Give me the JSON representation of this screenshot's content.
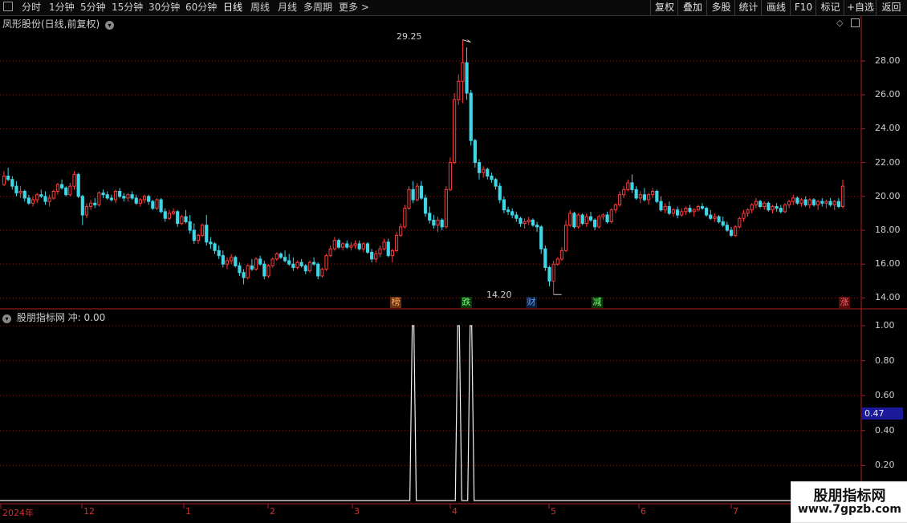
{
  "toolbar": {
    "menu_icon": "window-icon",
    "periods": [
      "分时",
      "1分钟",
      "5分钟",
      "15分钟",
      "30分钟",
      "60分钟",
      "日线",
      "周线",
      "月线",
      "多周期",
      "更多"
    ],
    "active_period": "日线",
    "right_buttons": [
      "复权",
      "叠加",
      "多股",
      "统计",
      "画线",
      "F10",
      "标记",
      "+自选",
      "返回"
    ]
  },
  "price_panel": {
    "title": "凤形股份(日线,前复权)",
    "high_label": "29.25",
    "low_label": "14.20",
    "y_ticks": [
      "28.00",
      "26.00",
      "24.00",
      "22.00",
      "20.00",
      "18.00",
      "16.00",
      "14.00"
    ],
    "badges": [
      {
        "text": "榜",
        "color": "#c86428"
      },
      {
        "text": "跌",
        "color": "#30c030"
      },
      {
        "text": "财",
        "color": "#2a78e0"
      },
      {
        "text": "减",
        "color": "#30c030"
      },
      {
        "text": "涨",
        "color": "#e03030"
      }
    ]
  },
  "indicator_panel": {
    "title": "股朋指标网 冲: 0.00",
    "y_ticks": [
      "1.00",
      "0.80",
      "0.60",
      "0.40",
      "0.20"
    ],
    "current_value": "0.47"
  },
  "x_axis": [
    "2024年",
    "12",
    "1",
    "2",
    "3",
    "4",
    "5",
    "6",
    "7"
  ],
  "watermark": {
    "line1": "股朋指标网",
    "line2": "www.7gpzb.com"
  },
  "colors": {
    "up": "#ff3b3b",
    "down": "#3fd6e6",
    "grid": "#7a1a1a",
    "axis": "#b02020"
  },
  "chart_data": {
    "type": "candlestick",
    "y_range": [
      13.5,
      29.8
    ],
    "ohlc": [
      [
        20.7,
        21.5,
        20.6,
        21.2
      ],
      [
        21.2,
        21.7,
        20.9,
        21.0
      ],
      [
        21.0,
        21.2,
        20.4,
        20.6
      ],
      [
        20.6,
        20.9,
        20.0,
        20.2
      ],
      [
        20.2,
        20.6,
        19.9,
        20.3
      ],
      [
        20.3,
        20.4,
        19.7,
        19.9
      ],
      [
        19.9,
        20.1,
        19.5,
        19.6
      ],
      [
        19.6,
        20.0,
        19.4,
        19.8
      ],
      [
        19.8,
        20.2,
        19.6,
        20.1
      ],
      [
        20.1,
        20.4,
        19.9,
        20.0
      ],
      [
        20.0,
        20.3,
        19.5,
        19.7
      ],
      [
        19.7,
        20.1,
        19.4,
        19.9
      ],
      [
        19.9,
        20.4,
        19.8,
        20.3
      ],
      [
        20.3,
        20.8,
        20.1,
        20.7
      ],
      [
        20.7,
        21.0,
        20.4,
        20.5
      ],
      [
        20.5,
        20.6,
        20.0,
        20.1
      ],
      [
        20.1,
        20.8,
        20.0,
        20.6
      ],
      [
        20.6,
        21.5,
        20.4,
        21.3
      ],
      [
        21.3,
        21.4,
        19.9,
        20.0
      ],
      [
        20.0,
        20.1,
        18.3,
        18.9
      ],
      [
        18.9,
        19.6,
        18.7,
        19.4
      ],
      [
        19.4,
        19.8,
        19.2,
        19.6
      ],
      [
        19.6,
        19.9,
        19.3,
        19.5
      ],
      [
        19.5,
        20.3,
        19.4,
        20.2
      ],
      [
        20.2,
        20.4,
        19.9,
        20.1
      ],
      [
        20.1,
        20.3,
        19.8,
        19.9
      ],
      [
        19.9,
        20.1,
        19.7,
        19.8
      ],
      [
        19.8,
        20.4,
        19.6,
        20.3
      ],
      [
        20.3,
        20.5,
        19.9,
        20.0
      ],
      [
        20.0,
        20.2,
        19.7,
        19.9
      ],
      [
        19.9,
        20.2,
        19.7,
        20.1
      ],
      [
        20.1,
        20.3,
        19.8,
        19.9
      ],
      [
        19.9,
        20.1,
        19.5,
        19.6
      ],
      [
        19.6,
        19.9,
        19.4,
        19.8
      ],
      [
        19.8,
        20.1,
        19.6,
        20.0
      ],
      [
        20.0,
        20.1,
        19.5,
        19.7
      ],
      [
        19.7,
        19.8,
        19.2,
        19.3
      ],
      [
        19.3,
        19.9,
        19.2,
        19.8
      ],
      [
        19.8,
        19.9,
        19.0,
        19.1
      ],
      [
        19.1,
        19.3,
        18.5,
        18.7
      ],
      [
        18.7,
        19.2,
        18.6,
        19.0
      ],
      [
        19.0,
        19.3,
        18.9,
        19.1
      ],
      [
        19.1,
        19.2,
        18.2,
        18.4
      ],
      [
        18.4,
        18.9,
        18.3,
        18.8
      ],
      [
        18.8,
        19.2,
        18.4,
        18.5
      ],
      [
        18.5,
        18.9,
        17.8,
        18.0
      ],
      [
        18.0,
        18.4,
        17.2,
        17.4
      ],
      [
        17.4,
        17.8,
        17.2,
        17.7
      ],
      [
        17.7,
        18.4,
        17.6,
        18.3
      ],
      [
        18.3,
        18.9,
        17.1,
        17.3
      ],
      [
        17.3,
        17.6,
        16.9,
        17.2
      ],
      [
        17.2,
        17.3,
        16.6,
        16.8
      ],
      [
        16.8,
        17.1,
        16.3,
        16.5
      ],
      [
        16.5,
        16.8,
        15.8,
        16.0
      ],
      [
        16.0,
        16.4,
        15.7,
        16.2
      ],
      [
        16.2,
        16.6,
        16.0,
        16.4
      ],
      [
        16.4,
        16.5,
        15.8,
        15.9
      ],
      [
        15.9,
        16.1,
        15.3,
        15.5
      ],
      [
        15.5,
        15.7,
        14.8,
        15.2
      ],
      [
        15.2,
        16.0,
        15.1,
        15.9
      ],
      [
        15.9,
        16.3,
        15.6,
        15.7
      ],
      [
        15.7,
        16.4,
        15.6,
        16.3
      ],
      [
        16.3,
        16.5,
        15.9,
        16.0
      ],
      [
        16.0,
        16.2,
        15.1,
        15.3
      ],
      [
        15.3,
        16.0,
        15.2,
        15.9
      ],
      [
        15.9,
        16.4,
        15.8,
        16.3
      ],
      [
        16.3,
        16.7,
        16.2,
        16.6
      ],
      [
        16.6,
        16.7,
        16.3,
        16.4
      ],
      [
        16.4,
        16.8,
        16.1,
        16.2
      ],
      [
        16.2,
        16.6,
        15.9,
        16.0
      ],
      [
        16.0,
        16.4,
        15.6,
        15.8
      ],
      [
        15.8,
        16.2,
        15.7,
        16.1
      ],
      [
        16.1,
        16.3,
        15.8,
        15.9
      ],
      [
        15.9,
        16.0,
        15.4,
        15.6
      ],
      [
        15.6,
        16.2,
        15.5,
        16.1
      ],
      [
        16.1,
        16.4,
        15.9,
        16.0
      ],
      [
        16.0,
        16.1,
        15.1,
        15.3
      ],
      [
        15.3,
        15.8,
        15.2,
        15.7
      ],
      [
        15.7,
        16.6,
        15.6,
        16.5
      ],
      [
        16.5,
        17.1,
        16.4,
        16.9
      ],
      [
        16.9,
        17.6,
        16.8,
        17.4
      ],
      [
        17.4,
        17.5,
        16.9,
        17.0
      ],
      [
        17.0,
        17.3,
        16.8,
        17.2
      ],
      [
        17.2,
        17.4,
        16.9,
        17.0
      ],
      [
        17.0,
        17.3,
        16.8,
        17.1
      ],
      [
        17.1,
        17.4,
        16.9,
        17.2
      ],
      [
        17.2,
        17.4,
        16.8,
        16.9
      ],
      [
        16.9,
        17.3,
        16.7,
        17.2
      ],
      [
        17.2,
        17.3,
        16.6,
        16.7
      ],
      [
        16.7,
        16.9,
        16.1,
        16.3
      ],
      [
        16.3,
        16.8,
        16.1,
        16.6
      ],
      [
        16.6,
        17.1,
        16.4,
        16.9
      ],
      [
        16.9,
        17.5,
        16.8,
        17.3
      ],
      [
        17.3,
        17.5,
        16.4,
        16.5
      ],
      [
        16.5,
        16.9,
        16.1,
        16.8
      ],
      [
        16.8,
        17.9,
        16.7,
        17.7
      ],
      [
        17.7,
        18.4,
        17.6,
        18.2
      ],
      [
        18.2,
        19.5,
        18.1,
        19.3
      ],
      [
        19.3,
        20.6,
        19.2,
        20.4
      ],
      [
        20.4,
        20.9,
        19.6,
        19.8
      ],
      [
        19.8,
        20.8,
        19.7,
        20.6
      ],
      [
        20.6,
        20.9,
        19.8,
        19.9
      ],
      [
        19.9,
        20.1,
        18.8,
        19.0
      ],
      [
        19.0,
        19.4,
        18.4,
        18.6
      ],
      [
        18.6,
        18.9,
        18.1,
        18.3
      ],
      [
        18.3,
        18.8,
        17.9,
        18.6
      ],
      [
        18.6,
        18.7,
        18.0,
        18.2
      ],
      [
        18.2,
        20.6,
        18.1,
        20.4
      ],
      [
        20.4,
        22.3,
        20.3,
        22.0
      ],
      [
        22.0,
        26.1,
        21.9,
        25.7
      ],
      [
        25.7,
        27.2,
        25.4,
        26.8
      ],
      [
        26.8,
        29.25,
        25.5,
        27.9
      ],
      [
        27.9,
        28.8,
        25.7,
        26.1
      ],
      [
        26.1,
        26.3,
        23.0,
        23.3
      ],
      [
        23.3,
        23.4,
        21.7,
        22.0
      ],
      [
        22.0,
        22.2,
        21.0,
        21.4
      ],
      [
        21.4,
        21.8,
        21.1,
        21.6
      ],
      [
        21.6,
        21.7,
        21.0,
        21.2
      ],
      [
        21.2,
        21.4,
        20.8,
        21.0
      ],
      [
        21.0,
        21.1,
        20.4,
        20.6
      ],
      [
        20.6,
        20.8,
        19.6,
        19.8
      ],
      [
        19.8,
        20.0,
        19.0,
        19.2
      ],
      [
        19.2,
        19.4,
        18.9,
        19.1
      ],
      [
        19.1,
        19.3,
        18.7,
        18.9
      ],
      [
        18.9,
        19.1,
        18.5,
        18.7
      ],
      [
        18.7,
        18.8,
        18.2,
        18.4
      ],
      [
        18.4,
        18.7,
        18.1,
        18.5
      ],
      [
        18.5,
        18.8,
        18.3,
        18.6
      ],
      [
        18.6,
        18.7,
        18.2,
        18.3
      ],
      [
        18.3,
        18.5,
        17.9,
        18.2
      ],
      [
        18.2,
        18.3,
        16.6,
        16.9
      ],
      [
        16.9,
        17.1,
        15.6,
        15.8
      ],
      [
        15.8,
        15.9,
        14.7,
        15.0
      ],
      [
        15.0,
        16.2,
        14.2,
        16.0
      ],
      [
        16.0,
        16.4,
        15.9,
        16.3
      ],
      [
        16.3,
        17.0,
        16.2,
        16.8
      ],
      [
        16.8,
        18.6,
        16.7,
        18.3
      ],
      [
        18.3,
        19.2,
        18.2,
        19.0
      ],
      [
        19.0,
        19.1,
        18.1,
        18.2
      ],
      [
        18.2,
        19.0,
        18.1,
        18.9
      ],
      [
        18.9,
        19.0,
        18.3,
        18.4
      ],
      [
        18.4,
        19.0,
        18.2,
        18.8
      ],
      [
        18.8,
        19.1,
        18.5,
        18.6
      ],
      [
        18.6,
        18.7,
        18.0,
        18.2
      ],
      [
        18.2,
        18.9,
        18.1,
        18.8
      ],
      [
        18.8,
        19.0,
        18.6,
        18.9
      ],
      [
        18.9,
        19.1,
        18.4,
        18.5
      ],
      [
        18.5,
        19.3,
        18.4,
        19.2
      ],
      [
        19.2,
        19.6,
        19.0,
        19.5
      ],
      [
        19.5,
        20.3,
        19.4,
        20.1
      ],
      [
        20.1,
        20.6,
        19.9,
        20.4
      ],
      [
        20.4,
        21.0,
        20.3,
        20.8
      ],
      [
        20.8,
        21.3,
        20.2,
        20.4
      ],
      [
        20.4,
        20.6,
        19.8,
        19.9
      ],
      [
        19.9,
        20.3,
        19.6,
        20.1
      ],
      [
        20.1,
        20.5,
        19.7,
        19.8
      ],
      [
        19.8,
        20.2,
        19.5,
        20.1
      ],
      [
        20.1,
        20.5,
        19.9,
        20.3
      ],
      [
        20.3,
        20.4,
        19.6,
        19.7
      ],
      [
        19.7,
        20.0,
        19.1,
        19.2
      ],
      [
        19.2,
        19.6,
        19.0,
        19.4
      ],
      [
        19.4,
        19.7,
        18.9,
        19.0
      ],
      [
        19.0,
        19.3,
        18.8,
        19.2
      ],
      [
        19.2,
        19.4,
        18.7,
        18.9
      ],
      [
        18.9,
        19.3,
        18.8,
        19.1
      ],
      [
        19.1,
        19.4,
        18.9,
        19.3
      ],
      [
        19.3,
        19.5,
        19.0,
        19.1
      ],
      [
        19.1,
        19.3,
        18.8,
        19.2
      ],
      [
        19.2,
        19.5,
        19.1,
        19.4
      ],
      [
        19.4,
        19.6,
        19.2,
        19.3
      ],
      [
        19.3,
        19.4,
        18.8,
        18.9
      ],
      [
        18.9,
        19.2,
        18.6,
        18.7
      ],
      [
        18.7,
        19.0,
        18.5,
        18.8
      ],
      [
        18.8,
        18.9,
        18.4,
        18.5
      ],
      [
        18.5,
        18.8,
        18.2,
        18.3
      ],
      [
        18.3,
        18.5,
        17.9,
        18.0
      ],
      [
        18.0,
        18.2,
        17.6,
        17.7
      ],
      [
        17.7,
        18.3,
        17.6,
        18.2
      ],
      [
        18.2,
        18.8,
        18.1,
        18.7
      ],
      [
        18.7,
        19.2,
        18.5,
        19.0
      ],
      [
        19.0,
        19.3,
        18.8,
        19.2
      ],
      [
        19.2,
        19.6,
        19.0,
        19.5
      ],
      [
        19.5,
        19.9,
        19.3,
        19.7
      ],
      [
        19.7,
        19.8,
        19.3,
        19.4
      ],
      [
        19.4,
        19.7,
        19.2,
        19.6
      ],
      [
        19.6,
        19.7,
        19.1,
        19.2
      ],
      [
        19.2,
        19.5,
        19.0,
        19.4
      ],
      [
        19.4,
        19.6,
        19.1,
        19.3
      ],
      [
        19.3,
        19.5,
        19.0,
        19.1
      ],
      [
        19.1,
        19.6,
        19.0,
        19.5
      ],
      [
        19.5,
        19.8,
        19.3,
        19.7
      ],
      [
        19.7,
        20.1,
        19.5,
        19.9
      ],
      [
        19.9,
        20.0,
        19.5,
        19.6
      ],
      [
        19.6,
        19.9,
        19.4,
        19.8
      ],
      [
        19.8,
        20.0,
        19.4,
        19.5
      ],
      [
        19.5,
        19.9,
        19.3,
        19.8
      ],
      [
        19.8,
        19.9,
        19.4,
        19.5
      ],
      [
        19.5,
        19.8,
        19.2,
        19.7
      ],
      [
        19.7,
        19.9,
        19.4,
        19.6
      ],
      [
        19.6,
        19.8,
        19.3,
        19.7
      ],
      [
        19.7,
        19.9,
        19.4,
        19.5
      ],
      [
        19.5,
        19.8,
        19.2,
        19.7
      ],
      [
        19.7,
        19.9,
        19.3,
        19.4
      ],
      [
        19.4,
        21.0,
        19.3,
        20.6
      ]
    ],
    "indicator_spikes": [
      {
        "bar": 99,
        "value": 1.0
      },
      {
        "bar": 110,
        "value": 1.0
      },
      {
        "bar": 113,
        "value": 1.0
      }
    ],
    "indicator_range": [
      0,
      1.0
    ]
  }
}
